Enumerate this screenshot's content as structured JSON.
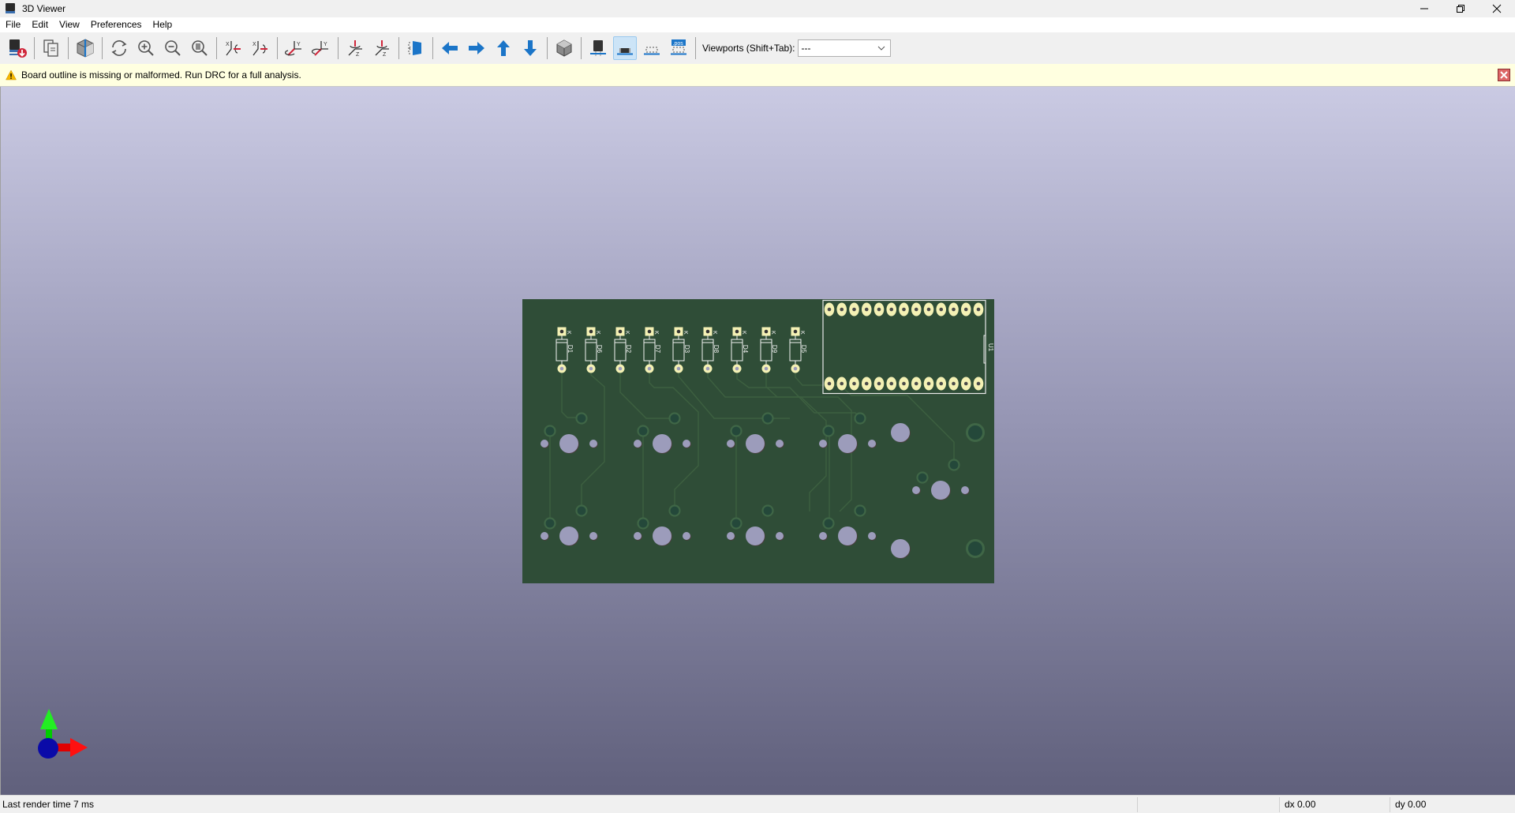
{
  "window": {
    "title": "3D Viewer",
    "controls": [
      "minimize",
      "maximize",
      "close"
    ]
  },
  "menubar": {
    "items": [
      {
        "label": "File"
      },
      {
        "label": "Edit"
      },
      {
        "label": "View"
      },
      {
        "label": "Preferences"
      },
      {
        "label": "Help"
      }
    ]
  },
  "toolbar": {
    "buttons": [
      {
        "icon": "export-image-icon",
        "tooltip": "Export image"
      },
      {
        "icon": "copy-clipboard-icon",
        "tooltip": "Copy to clipboard"
      },
      {
        "icon": "raytracing-icon",
        "tooltip": "Render raytracing"
      },
      {
        "icon": "reload-icon",
        "tooltip": "Reload board"
      },
      {
        "icon": "zoom-in-icon",
        "tooltip": "Zoom in"
      },
      {
        "icon": "zoom-out-icon",
        "tooltip": "Zoom out"
      },
      {
        "icon": "zoom-fit-icon",
        "tooltip": "Zoom to fit"
      },
      {
        "icon": "rotate-x-cw-icon",
        "tooltip": "Rotate X clockwise"
      },
      {
        "icon": "rotate-x-ccw-icon",
        "tooltip": "Rotate X counterclockwise"
      },
      {
        "icon": "rotate-y-cw-icon",
        "tooltip": "Rotate Y clockwise"
      },
      {
        "icon": "rotate-y-ccw-icon",
        "tooltip": "Rotate Y counterclockwise"
      },
      {
        "icon": "rotate-z-cw-icon",
        "tooltip": "Rotate Z clockwise"
      },
      {
        "icon": "rotate-z-ccw-icon",
        "tooltip": "Rotate Z counterclockwise"
      },
      {
        "icon": "flip-board-icon",
        "tooltip": "Flip board"
      },
      {
        "icon": "pan-left-icon",
        "tooltip": "Pan left"
      },
      {
        "icon": "pan-right-icon",
        "tooltip": "Pan right"
      },
      {
        "icon": "pan-up-icon",
        "tooltip": "Pan up"
      },
      {
        "icon": "pan-down-icon",
        "tooltip": "Pan down"
      },
      {
        "icon": "orthographic-icon",
        "tooltip": "Toggle orthographic"
      },
      {
        "icon": "show-tht-icon",
        "tooltip": "Show THT models"
      },
      {
        "icon": "show-smd-icon",
        "tooltip": "Show SMD models",
        "active": true
      },
      {
        "icon": "show-virtual-icon",
        "tooltip": "Show virtual models"
      },
      {
        "icon": "show-not-in-posfile-icon",
        "tooltip": "Show not in posfile"
      }
    ],
    "viewports_label": "Viewports (Shift+Tab):",
    "viewports_value": "---"
  },
  "infobar": {
    "message": "Board outline is missing or malformed. Run DRC for a full analysis."
  },
  "viewer": {
    "board_color": "#2f4d37",
    "pad_color": "#f4f1b4",
    "hole_color": "#9c9cbb",
    "silkscreen_color": "#f2f2f2",
    "diodes": [
      "D1",
      "D6",
      "D2",
      "D7",
      "D3",
      "D8",
      "D4",
      "D9",
      "D5"
    ],
    "diode_pad_label": "K",
    "ic": {
      "ref": "U1",
      "pins_per_row": 13
    },
    "axes": {
      "x_color": "#ff0000",
      "y_color": "#00e000",
      "z_color": "#0000c8"
    }
  },
  "statusbar": {
    "render_time": "Last render time 7 ms",
    "dx": "dx 0.00",
    "dy": "dy 0.00"
  }
}
